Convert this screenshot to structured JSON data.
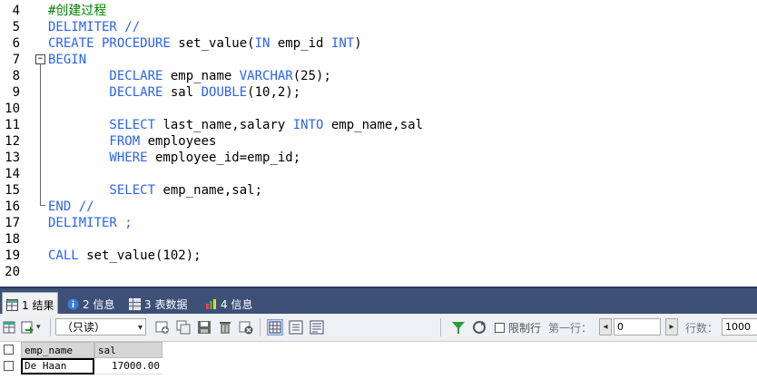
{
  "editor": {
    "lines": [
      {
        "n": "4",
        "segments": [
          {
            "t": "#创建过程",
            "c": "cm"
          }
        ]
      },
      {
        "n": "5",
        "segments": [
          {
            "t": "DELIMITER //",
            "c": "kw"
          }
        ]
      },
      {
        "n": "6",
        "segments": [
          {
            "t": "CREATE PROCEDURE ",
            "c": "kw"
          },
          {
            "t": "set_value(",
            "c": ""
          },
          {
            "t": "IN",
            "c": "kw"
          },
          {
            "t": " emp_id ",
            "c": ""
          },
          {
            "t": "INT",
            "c": "kw"
          },
          {
            "t": ")",
            "c": ""
          }
        ]
      },
      {
        "n": "7",
        "segments": [
          {
            "t": "BEGIN",
            "c": "kw"
          }
        ]
      },
      {
        "n": "8",
        "segments": [
          {
            "t": "        DECLARE",
            "c": "kw"
          },
          {
            "t": " emp_name ",
            "c": ""
          },
          {
            "t": "VARCHAR",
            "c": "kw"
          },
          {
            "t": "(25);",
            "c": ""
          }
        ]
      },
      {
        "n": "9",
        "segments": [
          {
            "t": "        DECLARE",
            "c": "kw"
          },
          {
            "t": " sal ",
            "c": ""
          },
          {
            "t": "DOUBLE",
            "c": "kw"
          },
          {
            "t": "(10,2);",
            "c": ""
          }
        ]
      },
      {
        "n": "10",
        "segments": []
      },
      {
        "n": "11",
        "segments": [
          {
            "t": "        SELECT",
            "c": "kw"
          },
          {
            "t": " last_name,salary ",
            "c": ""
          },
          {
            "t": "INTO",
            "c": "kw"
          },
          {
            "t": " emp_name,sal",
            "c": ""
          }
        ]
      },
      {
        "n": "12",
        "segments": [
          {
            "t": "        FROM",
            "c": "kw"
          },
          {
            "t": " employees",
            "c": ""
          }
        ]
      },
      {
        "n": "13",
        "segments": [
          {
            "t": "        WHERE",
            "c": "kw"
          },
          {
            "t": " employee_id=emp_id;",
            "c": ""
          }
        ]
      },
      {
        "n": "14",
        "segments": []
      },
      {
        "n": "15",
        "segments": [
          {
            "t": "        SELECT",
            "c": "kw"
          },
          {
            "t": " emp_name,sal;",
            "c": ""
          }
        ]
      },
      {
        "n": "16",
        "segments": [
          {
            "t": "END //",
            "c": "kw"
          }
        ]
      },
      {
        "n": "17",
        "segments": [
          {
            "t": "DELIMITER ;",
            "c": "kw"
          }
        ]
      },
      {
        "n": "18",
        "segments": []
      },
      {
        "n": "19",
        "segments": [
          {
            "t": "CALL",
            "c": "kw"
          },
          {
            "t": " set_value(102);",
            "c": ""
          }
        ]
      },
      {
        "n": "20",
        "segments": []
      }
    ]
  },
  "tabs": [
    {
      "label": "1 结果",
      "icon": "result-grid-icon"
    },
    {
      "label": "2 信息",
      "icon": "info-icon"
    },
    {
      "label": "3 表数据",
      "icon": "table-data-icon"
    },
    {
      "label": "4 信息",
      "icon": "info-chart-icon"
    }
  ],
  "toolbar": {
    "mode_select": "（只读）",
    "limit_label": "限制行",
    "first_row_label": "第一行：",
    "first_row_value": "0",
    "row_count_label": "行数：",
    "row_count_value": "1000"
  },
  "results": {
    "columns": [
      "emp_name",
      "sal"
    ],
    "rows": [
      [
        "De Haan",
        "17000.00"
      ]
    ]
  }
}
